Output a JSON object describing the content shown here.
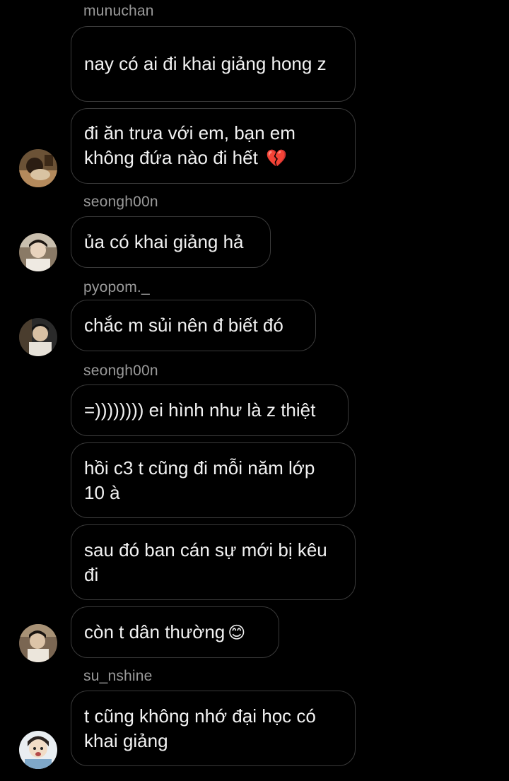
{
  "chat": {
    "messages": [
      {
        "sender": "munuchan",
        "text": "nay có ai đi khai giảng hong z"
      },
      {
        "text": "đi ăn trưa với em, bạn em không đứa nào đi hết",
        "emoji": "💔"
      },
      {
        "sender": "seongh00n",
        "text": "ủa có khai giảng hả"
      },
      {
        "sender": "pyopom._",
        "text": "chắc m sủi nên đ biết đó"
      },
      {
        "sender": "seongh00n",
        "text": "=)))))))) ei hình như là z thiệt"
      },
      {
        "text": "hồi c3 t cũng đi mỗi năm lớp 10 à"
      },
      {
        "text": "sau đó ban cán sự mới bị kêu đi"
      },
      {
        "text": "còn t dân thường",
        "emoji": "😊"
      },
      {
        "sender": "su_nshine",
        "text": "t cũng không nhớ đại học có khai giảng"
      }
    ]
  },
  "colors": {
    "background": "#000000",
    "bubble_border": "#3a3a3a",
    "username": "#9a9a9a",
    "message_text": "#f2f2f2"
  },
  "icons": {
    "heart": "broken-heart-icon",
    "smile": "smiling-face-icon"
  }
}
